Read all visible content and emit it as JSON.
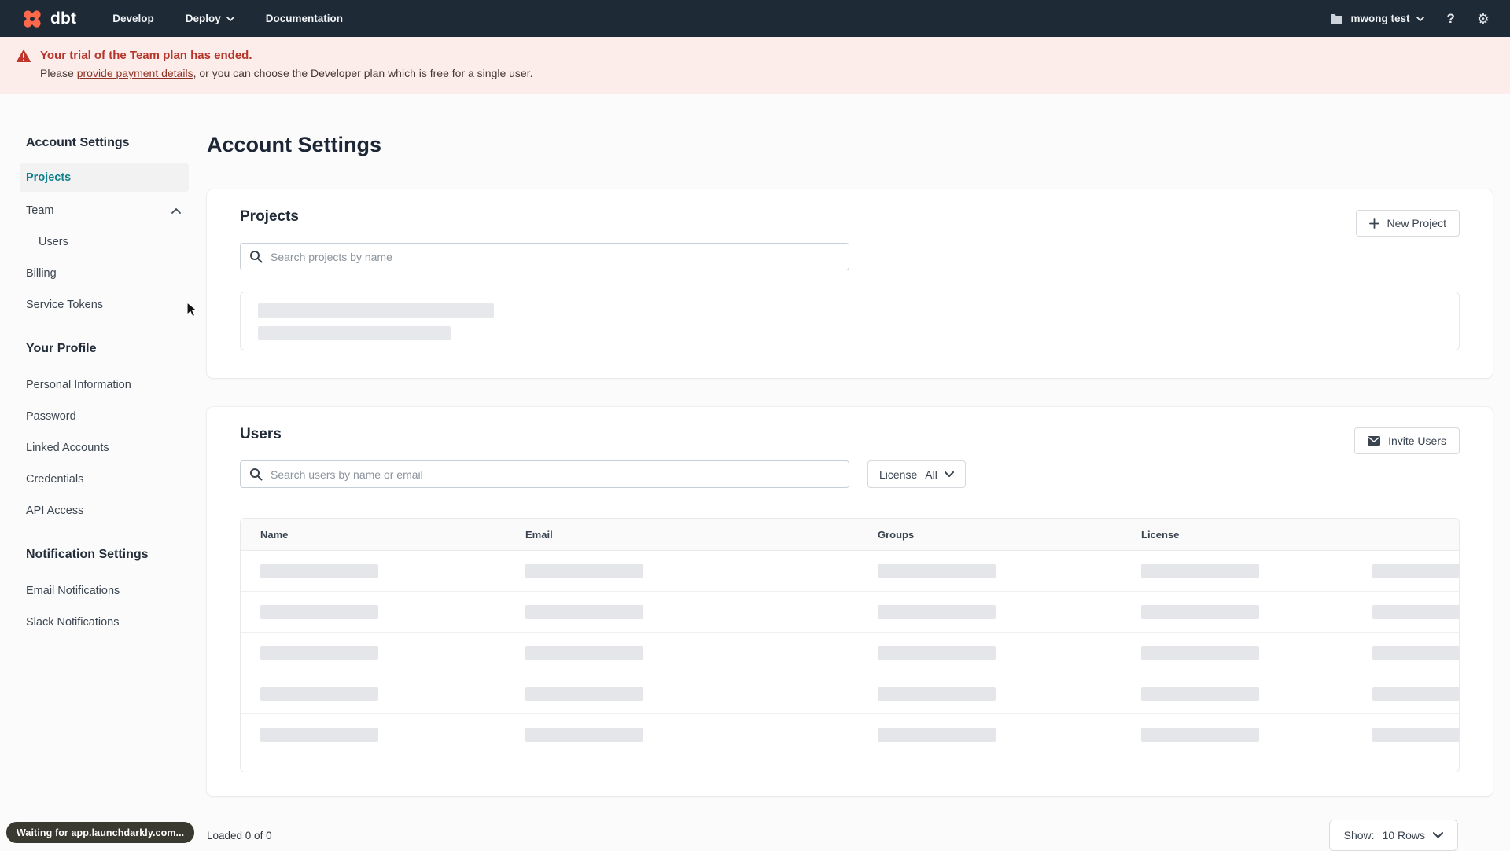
{
  "nav": {
    "brand": "dbt",
    "items": [
      {
        "label": "Develop"
      },
      {
        "label": "Deploy"
      },
      {
        "label": "Documentation"
      }
    ],
    "account_label": "mwong test",
    "help_label": "?"
  },
  "banner": {
    "title": "Your trial of the Team plan has ended.",
    "body_prefix": "Please ",
    "link_text": "provide payment details",
    "body_suffix": ", or you can choose the Developer plan which is free for a single user."
  },
  "sidebar": {
    "sections": [
      {
        "heading": "Account Settings",
        "items": [
          "Projects",
          "Team",
          "Users",
          "Billing",
          "Service Tokens"
        ]
      },
      {
        "heading": "Your Profile",
        "items": [
          "Personal Information",
          "Password",
          "Linked Accounts",
          "Credentials",
          "API Access"
        ]
      },
      {
        "heading": "Notification Settings",
        "items": [
          "Email Notifications",
          "Slack Notifications"
        ]
      }
    ],
    "active_item": "Projects"
  },
  "page": {
    "title": "Account Settings"
  },
  "projects_card": {
    "title": "Projects",
    "new_project_label": "New Project",
    "search_placeholder": "Search projects by name",
    "search_value": ""
  },
  "users_card": {
    "title": "Users",
    "invite_label": "Invite Users",
    "search_placeholder": "Search users by name or email",
    "search_value": "",
    "license_filter": {
      "label": "License",
      "value": "All"
    },
    "table": {
      "headers": [
        "Name",
        "Email",
        "Groups",
        "License"
      ]
    }
  },
  "table_footer": {
    "loaded_text": "Loaded 0 of 0",
    "show_label": "Show:",
    "show_value": "10 Rows"
  },
  "status_bubble": {
    "text": "Waiting for app.launchdarkly.com..."
  },
  "colors": {
    "nav_bg": "#1f2a37",
    "brand_orange": "#ff694b",
    "banner_bg": "#fdedea",
    "warning_red": "#b5352b",
    "accent_teal": "#12808c",
    "skeleton_gray": "#e5e7ea"
  }
}
